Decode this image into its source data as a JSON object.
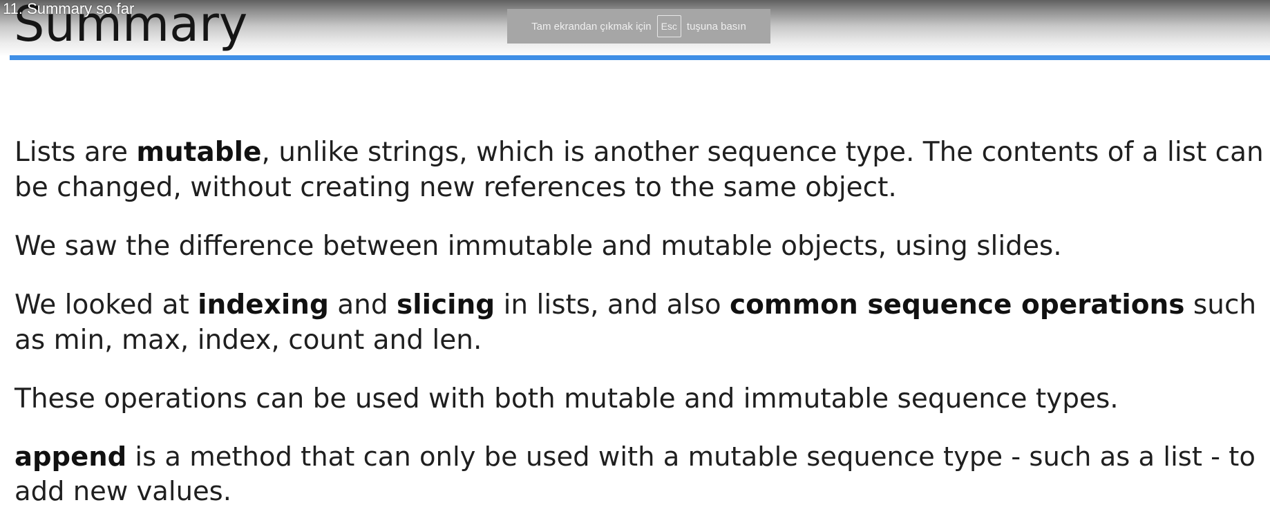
{
  "video": {
    "title": "11. Summary so far"
  },
  "fullscreen_notice": {
    "before": "Tam ekrandan çıkmak için",
    "key": "Esc",
    "after": "tuşuna basın"
  },
  "slide": {
    "title": "Summary",
    "accent_color": "#3f8fe6",
    "paragraphs": [
      {
        "line1": {
          "t1": "Lists are ",
          "b1": "mutable",
          "t2": ", unlike strings, which is another sequence type. The contents of a list can"
        },
        "line2": "be changed, without creating new references to the same object."
      },
      {
        "line1": "We saw the difference between immutable and mutable objects, using slides."
      },
      {
        "line1": {
          "t1": "We looked at ",
          "b1": "indexing",
          "t2": " and ",
          "b2": "slicing",
          "t3": " in lists, and also ",
          "b3": "common sequence operations",
          "t4": " such"
        },
        "line2": "as min, max, index, count and len."
      },
      {
        "line1": "These operations can be used with both mutable and immutable sequence types."
      },
      {
        "line1": {
          "b1": "append",
          "t1": " is a method that can only be used with a mutable sequence type - such as a list - to"
        },
        "line2": "add new values."
      }
    ]
  }
}
